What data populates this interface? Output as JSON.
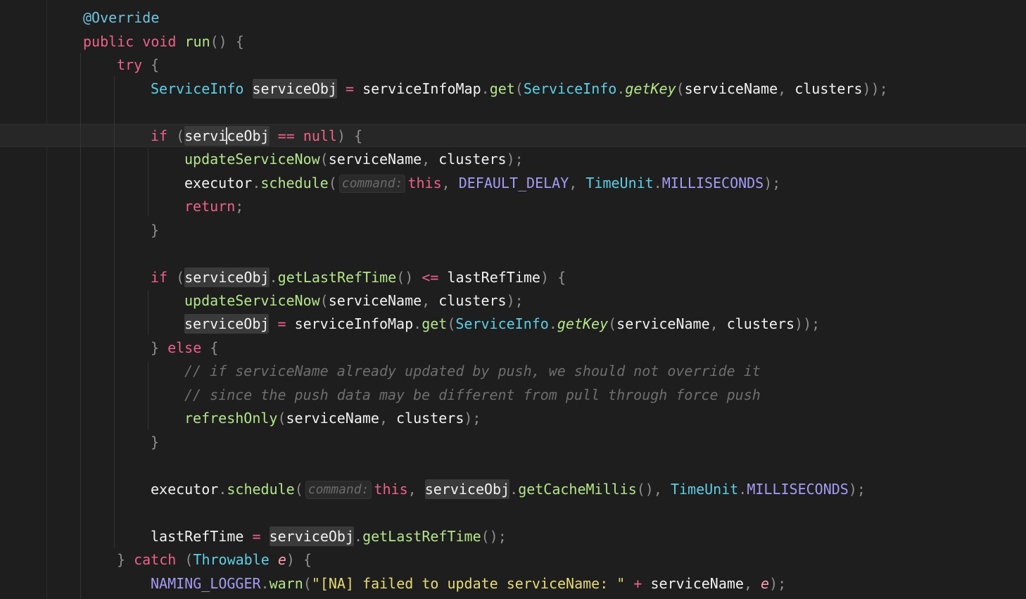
{
  "code": {
    "l1": {
      "annotation": "@Override"
    },
    "l2": {
      "kw_public": "public",
      "kw_void": "void",
      "method": "run",
      "parens": "()",
      "brace": "{"
    },
    "l3": {
      "kw_try": "try",
      "brace": "{"
    },
    "l4": {
      "type": "ServiceInfo",
      "var": "serviceObj",
      "eq": "=",
      "map": "serviceInfoMap",
      "dot1": ".",
      "get": "get",
      "lp": "(",
      "type2": "ServiceInfo",
      "dot2": ".",
      "getKey": "getKey",
      "lp2": "(",
      "arg1": "serviceName",
      "comma": ",",
      "arg2": "clusters",
      "tail": "));"
    },
    "l5": {
      "kw_if": "if",
      "lp": "(",
      "var_pre": "servi",
      "var_post": "ceObj",
      "op": "==",
      "null": "null",
      "rp": ")",
      "brace": "{"
    },
    "l6": {
      "fn": "updateServiceNow",
      "lp": "(",
      "arg1": "serviceName",
      "comma": ",",
      "arg2": "clusters",
      "tail": ");"
    },
    "l7": {
      "obj": "executor",
      "dot": ".",
      "fn": "schedule",
      "lp": "(",
      "hint": "command:",
      "this": "this",
      "comma1": ",",
      "const1": "DEFAULT_DELAY",
      "comma2": ",",
      "type": "TimeUnit",
      "dot2": ".",
      "const2": "MILLISECONDS",
      "tail": ");"
    },
    "l8": {
      "kw_return": "return",
      "semi": ";"
    },
    "l9": {
      "brace": "}"
    },
    "l10": {
      "kw_if": "if",
      "lp": "(",
      "var": "serviceObj",
      "dot": ".",
      "fn": "getLastRefTime",
      "parens": "()",
      "op": "<=",
      "ident": "lastRefTime",
      "rp": ")",
      "brace": "{"
    },
    "l11": {
      "fn": "updateServiceNow",
      "lp": "(",
      "arg1": "serviceName",
      "comma": ",",
      "arg2": "clusters",
      "tail": ");"
    },
    "l12": {
      "var": "serviceObj",
      "eq": "=",
      "map": "serviceInfoMap",
      "dot1": ".",
      "get": "get",
      "lp": "(",
      "type": "ServiceInfo",
      "dot2": ".",
      "getKey": "getKey",
      "lp2": "(",
      "arg1": "serviceName",
      "comma": ",",
      "arg2": "clusters",
      "tail": "));"
    },
    "l13": {
      "rbrace": "}",
      "kw_else": "else",
      "brace": "{"
    },
    "l14": {
      "comment": "// if serviceName already updated by push, we should not override it"
    },
    "l15": {
      "comment": "// since the push data may be different from pull through force push"
    },
    "l16": {
      "fn": "refreshOnly",
      "lp": "(",
      "arg1": "serviceName",
      "comma": ",",
      "arg2": "clusters",
      "tail": ");"
    },
    "l17": {
      "brace": "}"
    },
    "l18": {
      "obj": "executor",
      "dot": ".",
      "fn": "schedule",
      "lp": "(",
      "hint": "command:",
      "this": "this",
      "comma1": ",",
      "var": "serviceObj",
      "dot2": ".",
      "fn2": "getCacheMillis",
      "parens": "()",
      "comma2": ",",
      "type": "TimeUnit",
      "dot3": ".",
      "const": "MILLISECONDS",
      "tail": ");"
    },
    "l19": {
      "ident": "lastRefTime",
      "eq": "=",
      "var": "serviceObj",
      "dot": ".",
      "fn": "getLastRefTime",
      "tail": "();"
    },
    "l20": {
      "rbrace": "}",
      "kw_catch": "catch",
      "lp": "(",
      "type": "Throwable",
      "param": "e",
      "rp": ")",
      "brace": "{"
    },
    "l21": {
      "const": "NAMING_LOGGER",
      "dot": ".",
      "fn": "warn",
      "lp": "(",
      "str": "\"[NA] failed to update serviceName: \"",
      "plus": "+",
      "ident": "serviceName",
      "comma": ",",
      "param": "e",
      "tail": ");"
    }
  },
  "colors": {
    "background": "#1e1e1e",
    "keyword": "#f0608a",
    "function": "#b4e68a",
    "type": "#5ccfe6",
    "constant": "#a59bf5",
    "string": "#e6db74",
    "comment": "#6e6e6e"
  }
}
